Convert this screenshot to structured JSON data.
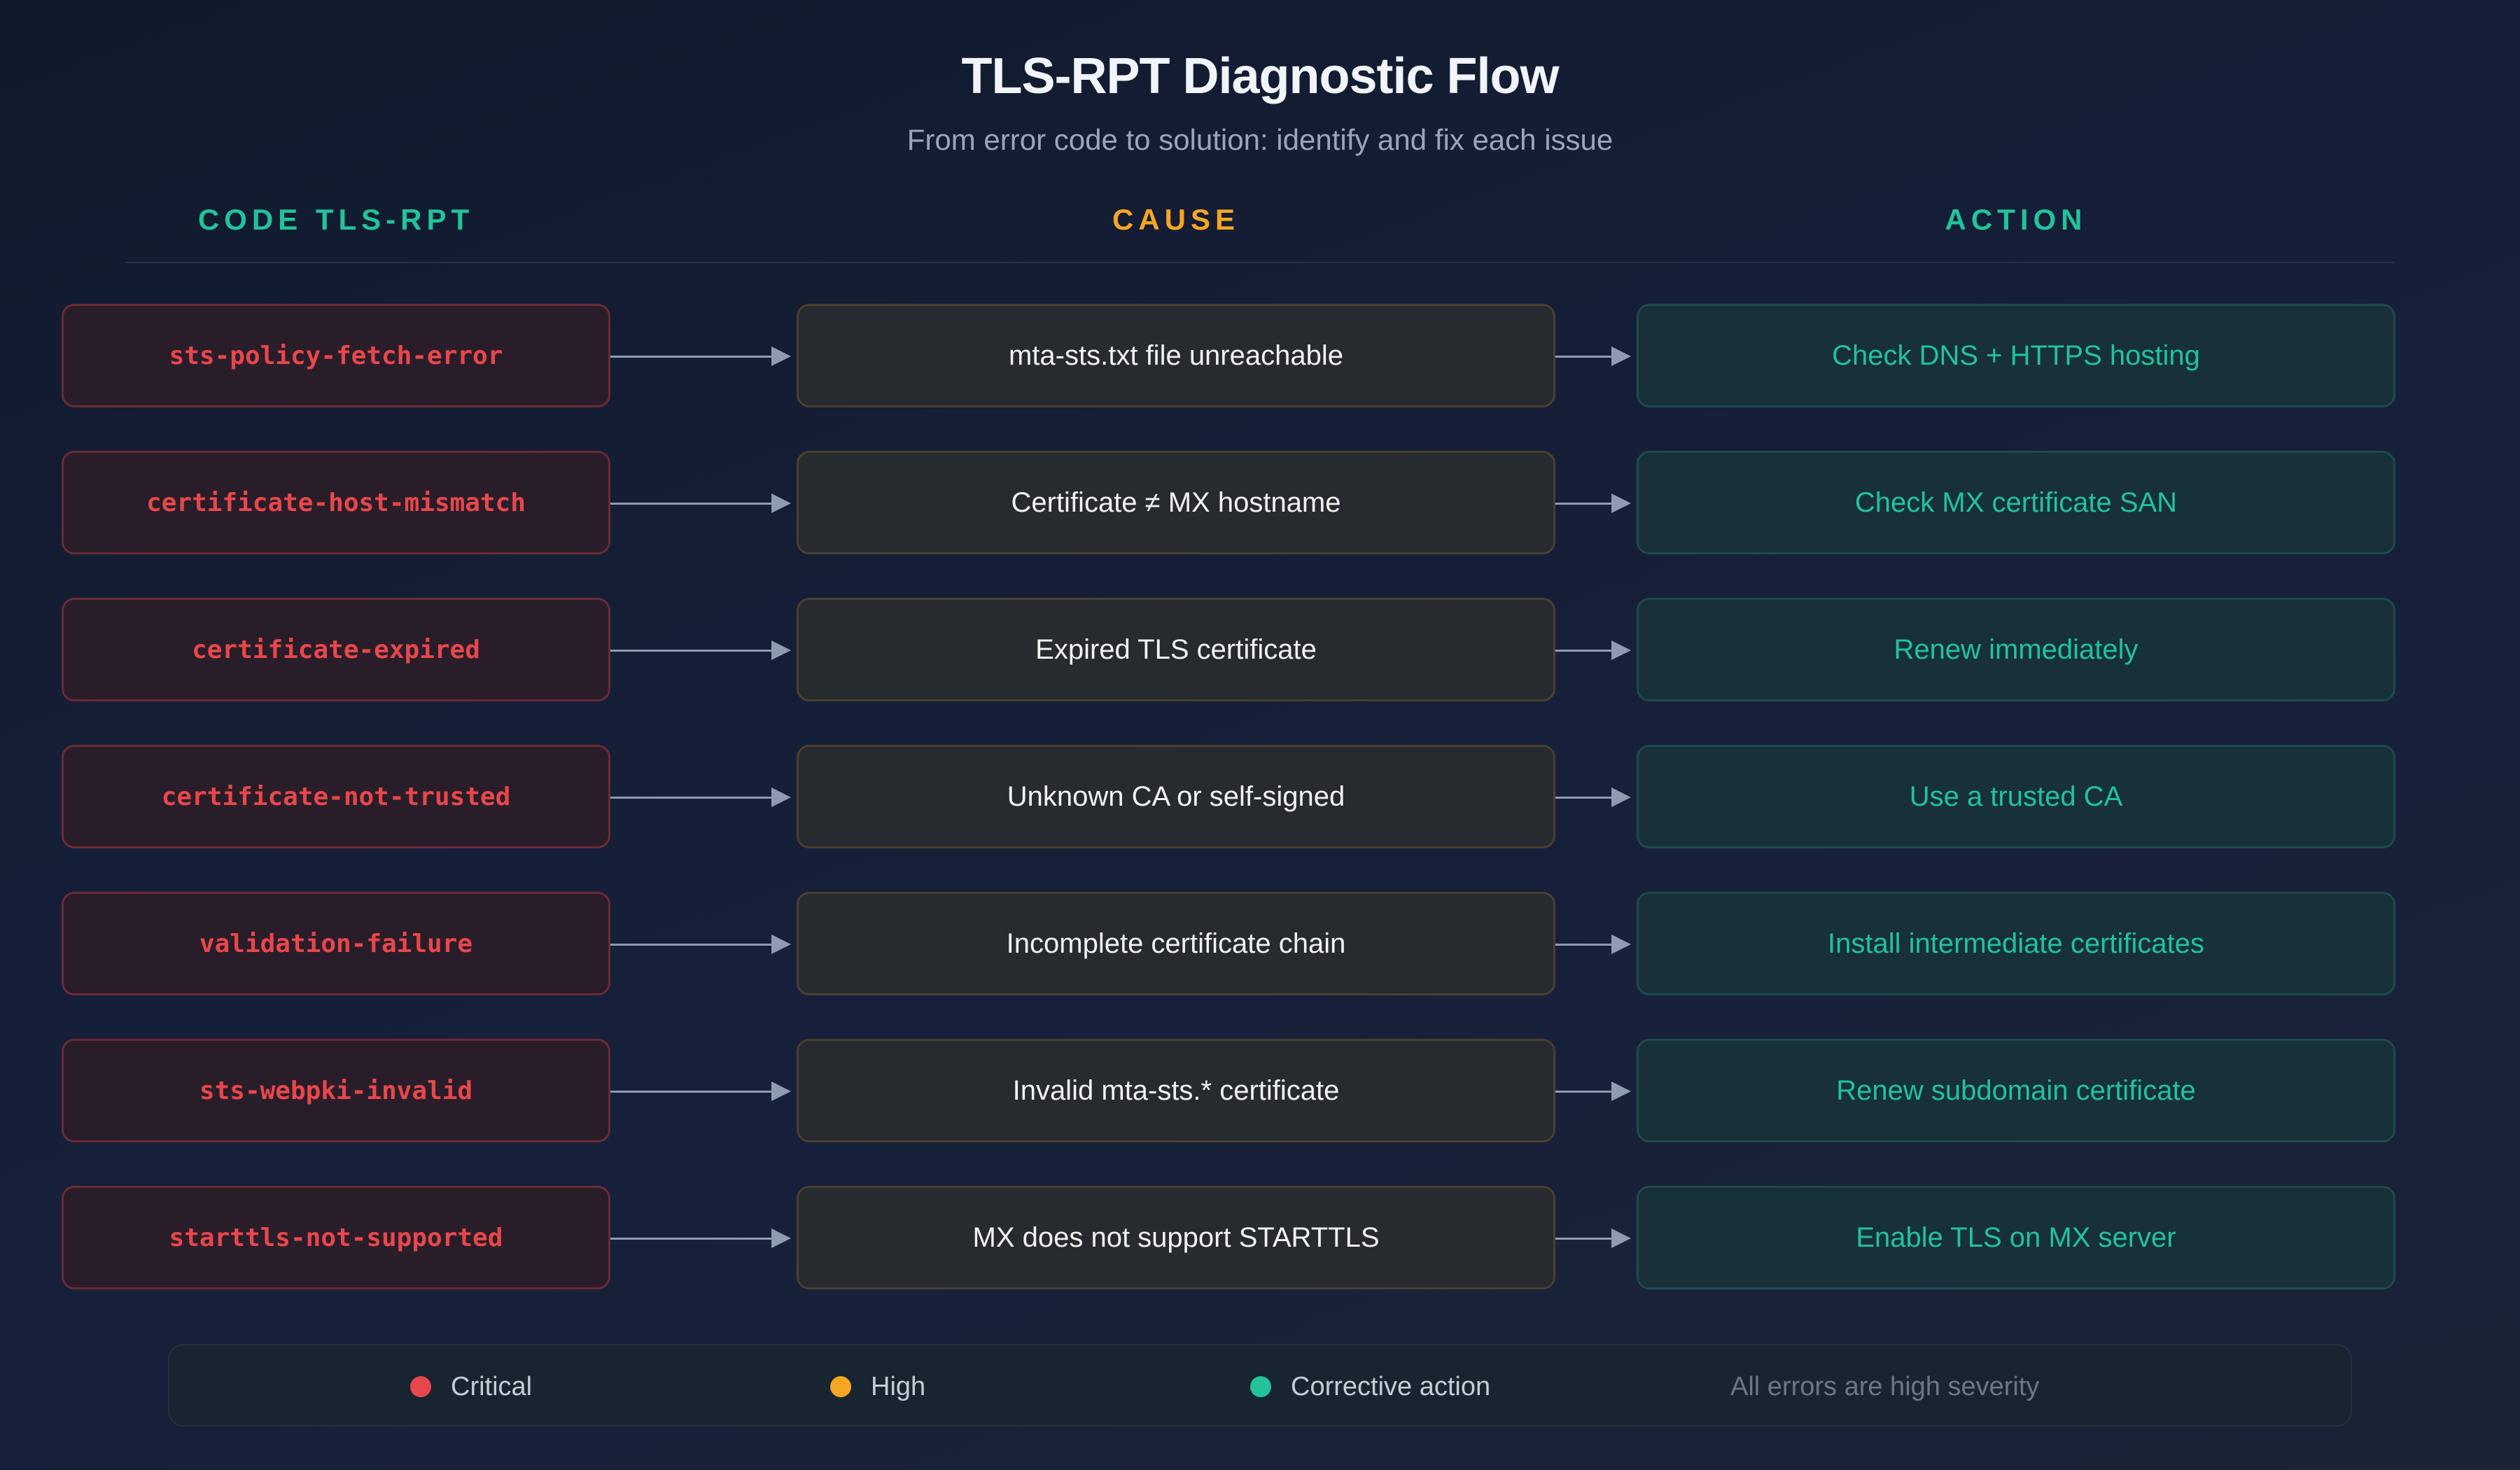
{
  "header": {
    "title": "TLS-RPT Diagnostic Flow",
    "subtitle": "From error code to solution: identify and fix each issue"
  },
  "columns": {
    "code": "CODE TLS-RPT",
    "cause": "CAUSE",
    "action": "ACTION"
  },
  "colors": {
    "critical": "#e8474b",
    "high": "#f5a623",
    "corrective": "#22c39a"
  },
  "rows": [
    {
      "code": "sts-policy-fetch-error",
      "cause": "mta-sts.txt file unreachable",
      "action": "Check DNS + HTTPS hosting"
    },
    {
      "code": "certificate-host-mismatch",
      "cause": "Certificate ≠ MX hostname",
      "action": "Check MX certificate SAN"
    },
    {
      "code": "certificate-expired",
      "cause": "Expired TLS certificate",
      "action": "Renew immediately"
    },
    {
      "code": "certificate-not-trusted",
      "cause": "Unknown CA or self-signed",
      "action": "Use a trusted CA"
    },
    {
      "code": "validation-failure",
      "cause": "Incomplete certificate chain",
      "action": "Install intermediate certificates"
    },
    {
      "code": "sts-webpki-invalid",
      "cause": "Invalid mta-sts.* certificate",
      "action": "Renew subdomain certificate"
    },
    {
      "code": "starttls-not-supported",
      "cause": "MX does not support STARTTLS",
      "action": "Enable TLS on MX server"
    }
  ],
  "legend": {
    "critical": "Critical",
    "high": "High",
    "corrective": "Corrective action",
    "note": "All errors are high severity"
  }
}
